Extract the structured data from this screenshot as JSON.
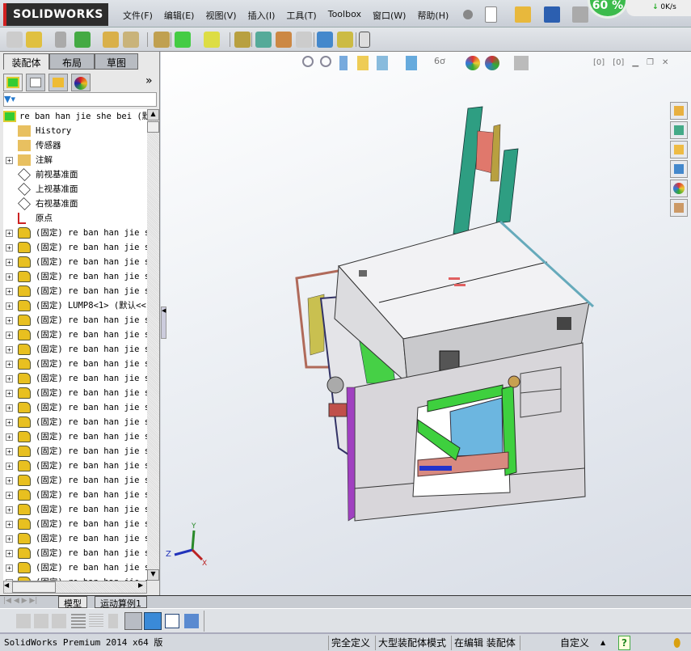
{
  "app": {
    "logo": "SOLIDWORKS"
  },
  "menu": [
    "文件(F)",
    "编辑(E)",
    "视图(V)",
    "插入(I)",
    "工具(T)",
    "Toolbox",
    "窗口(W)",
    "帮助(H)"
  ],
  "network": {
    "percent": "60 %",
    "speed": "0K/s"
  },
  "left_panel": {
    "tabs": [
      "装配体",
      "布局",
      "草图"
    ],
    "tree": {
      "root": "re ban han jie she bei  (默",
      "items": [
        {
          "label": "History",
          "icon": "history-folder-icon",
          "expand": false
        },
        {
          "label": "传感器",
          "icon": "sensor-folder-icon",
          "expand": false
        },
        {
          "label": "注解",
          "icon": "annotation-folder-icon",
          "expand": true
        },
        {
          "label": "前视基准面",
          "icon": "plane-icon",
          "expand": false
        },
        {
          "label": "上视基准面",
          "icon": "plane-icon",
          "expand": false
        },
        {
          "label": "右视基准面",
          "icon": "plane-icon",
          "expand": false
        },
        {
          "label": "原点",
          "icon": "origin-icon",
          "expand": false
        },
        {
          "label": "(固定) re ban han jie s",
          "icon": "part-icon",
          "expand": true
        },
        {
          "label": "(固定) re ban han jie s",
          "icon": "part-icon",
          "expand": true
        },
        {
          "label": "(固定) re ban han jie s",
          "icon": "part-icon",
          "expand": true
        },
        {
          "label": "(固定) re ban han jie s",
          "icon": "part-icon",
          "expand": true
        },
        {
          "label": "(固定) re ban han jie s",
          "icon": "part-icon",
          "expand": true
        },
        {
          "label": "(固定) LUMP8<1> (默认<<",
          "icon": "part-icon",
          "expand": true
        },
        {
          "label": "(固定) re ban han jie s",
          "icon": "part-icon",
          "expand": true
        },
        {
          "label": "(固定) re ban han jie s",
          "icon": "part-icon",
          "expand": true
        },
        {
          "label": "(固定) re ban han jie s",
          "icon": "part-icon",
          "expand": true
        },
        {
          "label": "(固定) re ban han jie s",
          "icon": "part-icon",
          "expand": true
        },
        {
          "label": "(固定) re ban han jie s",
          "icon": "part-icon",
          "expand": true
        },
        {
          "label": "(固定) re ban han jie s",
          "icon": "part-icon",
          "expand": true
        },
        {
          "label": "(固定) re ban han jie s",
          "icon": "part-icon",
          "expand": true
        },
        {
          "label": "(固定) re ban han jie s",
          "icon": "part-icon",
          "expand": true
        },
        {
          "label": "(固定) re ban han jie s",
          "icon": "part-icon",
          "expand": true
        },
        {
          "label": "(固定) re ban han jie s",
          "icon": "part-icon",
          "expand": true
        },
        {
          "label": "(固定) re ban han jie s",
          "icon": "part-icon",
          "expand": true
        },
        {
          "label": "(固定) re ban han jie s",
          "icon": "part-icon",
          "expand": true
        },
        {
          "label": "(固定) re ban han jie s",
          "icon": "part-icon",
          "expand": true
        },
        {
          "label": "(固定) re ban han jie s",
          "icon": "part-icon",
          "expand": true
        },
        {
          "label": "(固定) re ban han jie s",
          "icon": "part-icon",
          "expand": true
        },
        {
          "label": "(固定) re ban han jie s",
          "icon": "part-icon",
          "expand": true
        },
        {
          "label": "(固定) re ban han jie s",
          "icon": "part-icon",
          "expand": true
        },
        {
          "label": "(固定) re ban han jie s",
          "icon": "part-icon",
          "expand": true
        },
        {
          "label": "(固定) re ban han jie s",
          "icon": "part-icon",
          "expand": true
        },
        {
          "label": "(固定) re ban han jie s",
          "icon": "part-icon",
          "expand": true
        }
      ]
    }
  },
  "triad": {
    "x": "X",
    "y": "Y",
    "z": "Z"
  },
  "bottom_tabs": [
    "模型",
    "运动算例1"
  ],
  "status": {
    "product": "SolidWorks Premium 2014 x64 版",
    "defined": "完全定义",
    "mode": "大型装配体模式",
    "editing": "在编辑 装配体",
    "units": "自定义",
    "help": "?"
  }
}
